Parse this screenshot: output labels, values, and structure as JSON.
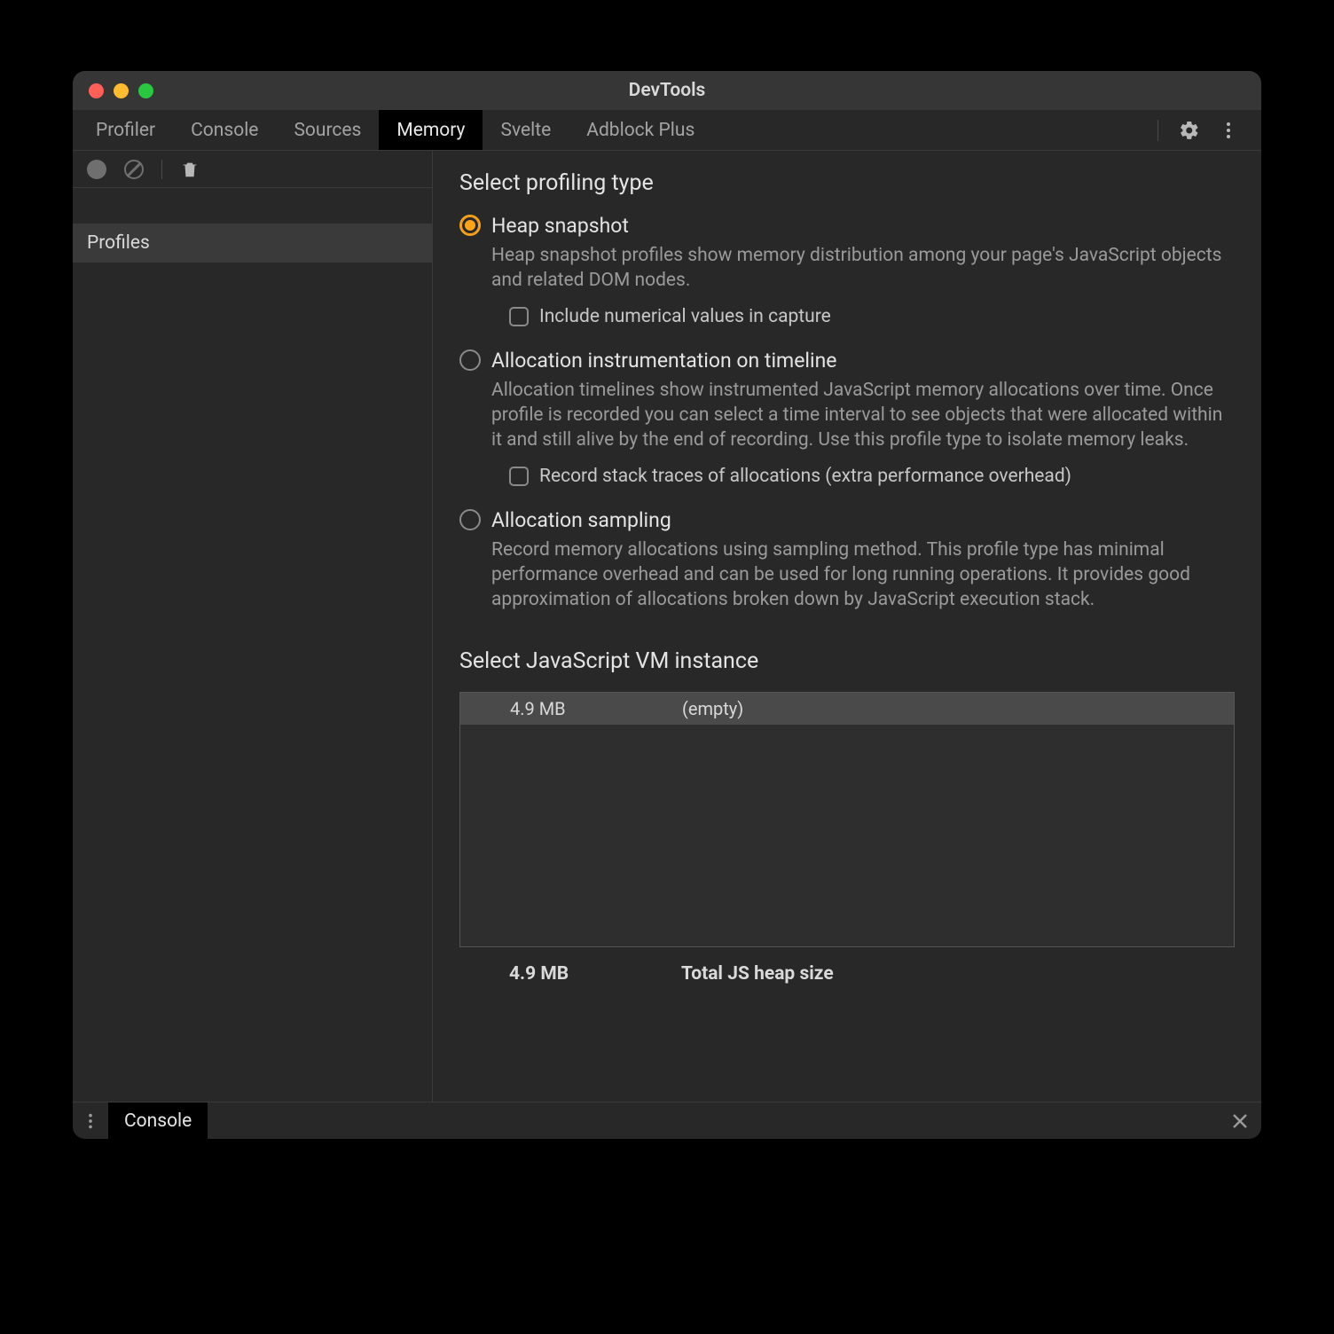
{
  "window": {
    "title": "DevTools"
  },
  "tabs": {
    "items": [
      "Profiler",
      "Console",
      "Sources",
      "Memory",
      "Svelte",
      "Adblock Plus"
    ],
    "active": "Memory"
  },
  "sidebar": {
    "section_label": "Profiles"
  },
  "main": {
    "heading_profiling": "Select profiling type",
    "heading_vm": "Select JavaScript VM instance",
    "options": [
      {
        "id": "heap",
        "title": "Heap snapshot",
        "desc": "Heap snapshot profiles show memory distribution among your page's JavaScript objects and related DOM nodes.",
        "checkbox_label": "Include numerical values in capture",
        "selected": true
      },
      {
        "id": "alloc-timeline",
        "title": "Allocation instrumentation on timeline",
        "desc": "Allocation timelines show instrumented JavaScript memory allocations over time. Once profile is recorded you can select a time interval to see objects that were allocated within it and still alive by the end of recording. Use this profile type to isolate memory leaks.",
        "checkbox_label": "Record stack traces of allocations (extra performance overhead)",
        "selected": false
      },
      {
        "id": "alloc-sampling",
        "title": "Allocation sampling",
        "desc": "Record memory allocations using sampling method. This profile type has minimal performance overhead and can be used for long running operations. It provides good approximation of allocations broken down by JavaScript execution stack.",
        "selected": false
      }
    ],
    "vm_instances": [
      {
        "size": "4.9 MB",
        "name": "(empty)"
      }
    ],
    "summary": {
      "size": "4.9 MB",
      "label": "Total JS heap size"
    }
  },
  "drawer": {
    "tab": "Console"
  }
}
